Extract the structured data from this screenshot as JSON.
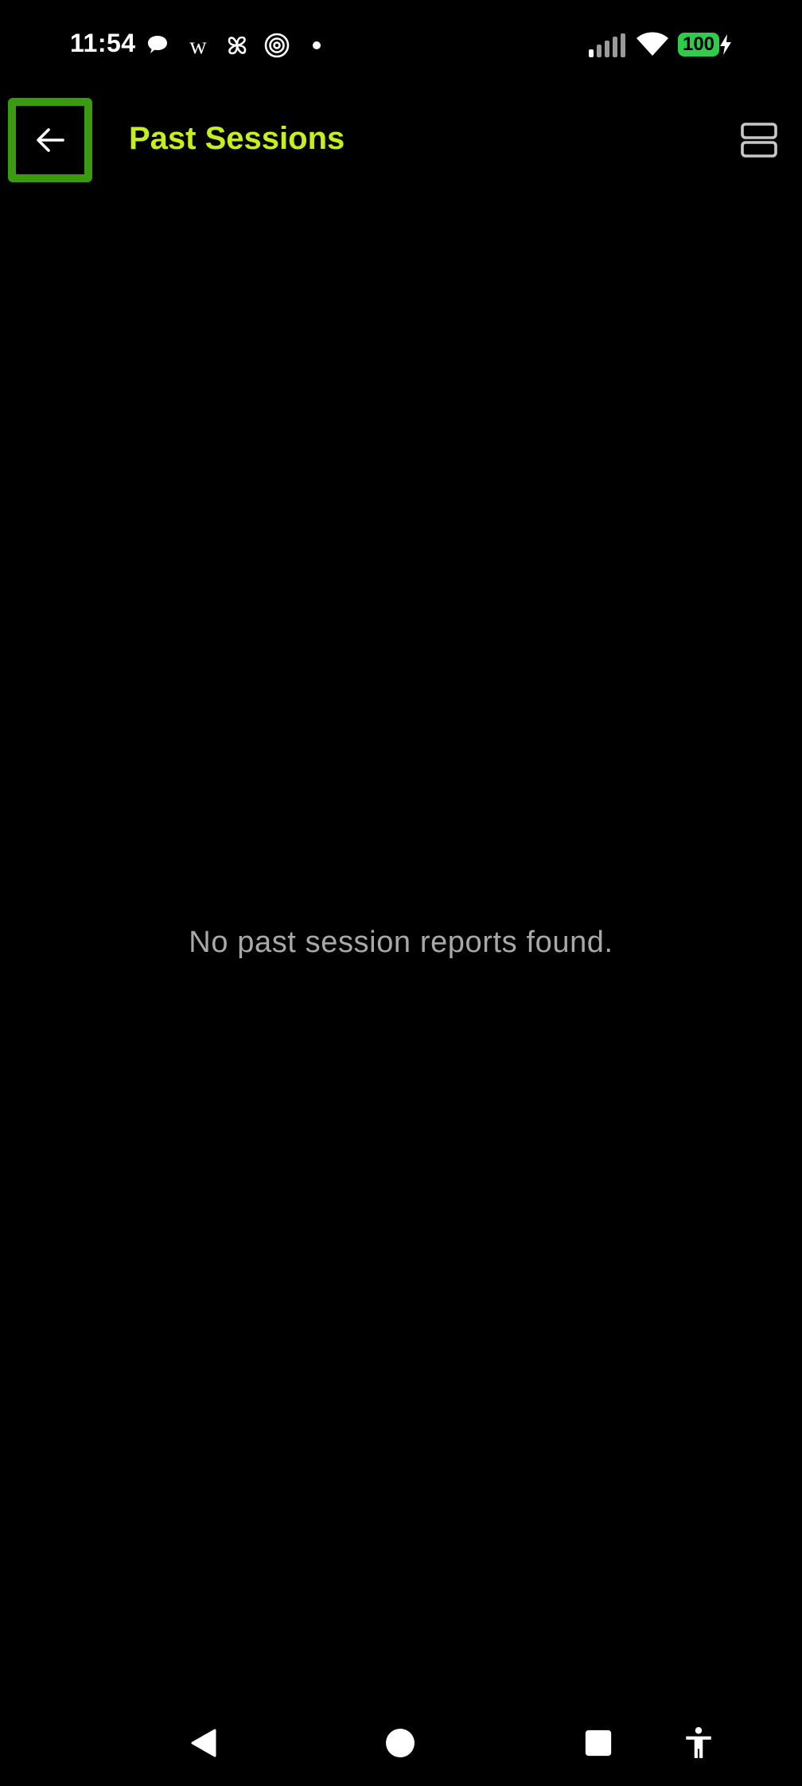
{
  "status_bar": {
    "time": "11:54",
    "notification_icons": [
      "chat-bubble-icon",
      "w-logo-icon",
      "pinwheel-icon",
      "spiral-icon",
      "dot-icon"
    ],
    "w_glyph": "w",
    "battery_level": "100",
    "battery_color": "#2ecc4a",
    "charging": true
  },
  "app_bar": {
    "title": "Past Sessions",
    "title_color": "#c6ef1e",
    "back_icon": "arrow-left-icon",
    "back_highlight_color": "#3a9a12",
    "view_toggle_icon": "view-agenda-icon"
  },
  "content": {
    "empty_message": "No past session reports found."
  },
  "nav_bar": {
    "buttons": [
      "back-triangle-icon",
      "home-circle-icon",
      "recents-square-icon",
      "accessibility-icon"
    ]
  }
}
